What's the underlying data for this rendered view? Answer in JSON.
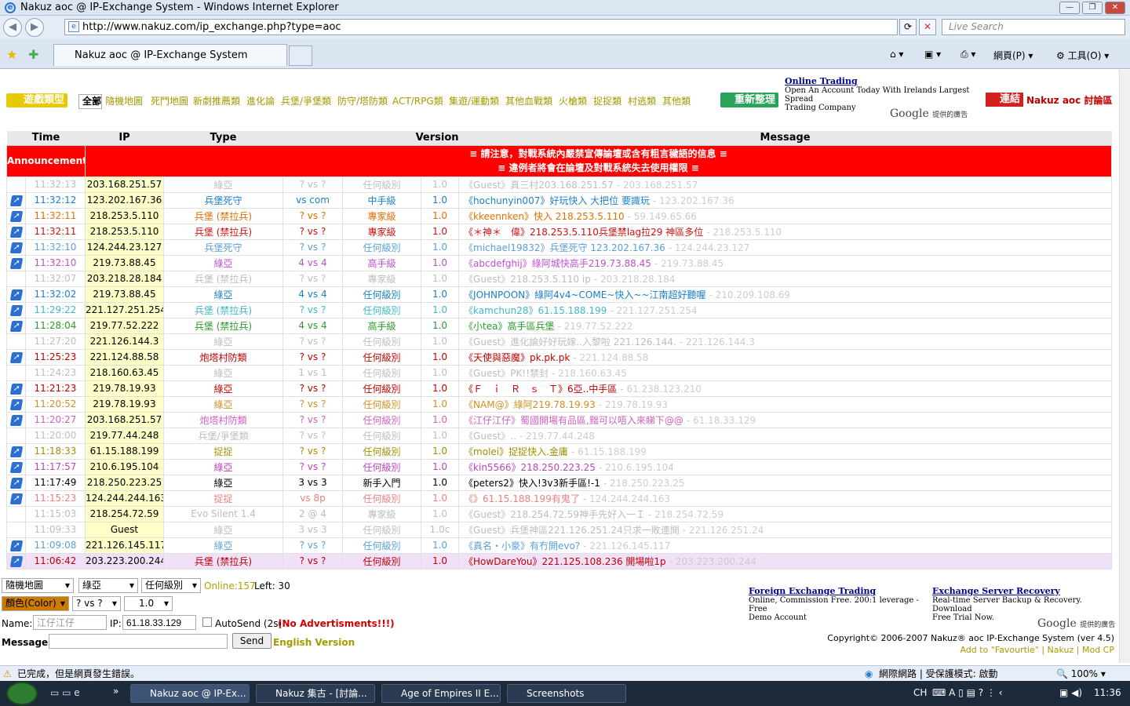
{
  "window": {
    "title": "Nakuz aoc @ IP-Exchange System - Windows Internet Explorer"
  },
  "nav": {
    "url": "http://www.nakuz.com/ip_exchange.php?type=aoc",
    "search_placeholder": "Live Search"
  },
  "tab": {
    "label": "Nakuz aoc @ IP-Exchange System"
  },
  "commands": {
    "page": "網頁(P)",
    "tools": "工具(O)"
  },
  "header": {
    "game_type_label": "遊戲類型",
    "categories": [
      "全部",
      "隨機地圖",
      "死鬥地圖",
      "新劇推薦類",
      "進化論",
      "兵堡/爭堡類",
      "防守/塔防類",
      "ACT/RPG類",
      "集遊/運動類",
      "其他血戰類",
      "火槍類",
      "捉捉類",
      "村逃類",
      "其他類"
    ],
    "renew_label": "重新整理",
    "link_label": "連結",
    "forum_link": "Nakuz  aoc 討論區"
  },
  "ad_top": {
    "title": "Online Trading",
    "line1": "Open An Account Today With Irelands Largest Spread",
    "line2": "Trading Company",
    "google": "Google",
    "google_sub": "提供的廣告"
  },
  "columns": {
    "time": "Time",
    "ip": "IP",
    "type": "Type",
    "version": "Version",
    "message": "Message"
  },
  "announcement": {
    "label": "Announcement",
    "line1": "≡ 請注意，對戰系統內嚴禁宣傳論壇或含有粗言穢語的信息 ≡",
    "line2": "≡ 違例者將會在論壇及對戰系統失去使用權限 ≡"
  },
  "rows": [
    {
      "icon": false,
      "time": "11:32:13",
      "ip": "203.168.251.57",
      "type": "綠亞",
      "vs": "? vs ?",
      "level": "任何級別",
      "ver": "1.0",
      "msg": "《Guest》真三村203.168.251.57",
      "ip2": "- 203.168.251.57",
      "color": "#bdbdbd"
    },
    {
      "icon": true,
      "time": "11:32:12",
      "ip": "123.202.167.36",
      "type": "兵堡死守",
      "vs": "vs com",
      "level": "中手級",
      "ver": "1.0",
      "msg": "《hochunyin007》好玩快入 大把位 要識玩",
      "ip2": "- 123.202.167.36",
      "color": "#1a7fc8"
    },
    {
      "icon": true,
      "time": "11:32:11",
      "ip": "218.253.5.110",
      "type": "兵堡 (禁拉兵)",
      "vs": "? vs ?",
      "level": "專家級",
      "ver": "1.0",
      "msg": "《kkeennken》快入 218.253.5.110",
      "ip2": "- 59.149.65.66",
      "color": "#e07000"
    },
    {
      "icon": true,
      "time": "11:32:11",
      "ip": "218.253.5.110",
      "type": "兵堡 (禁拉兵)",
      "vs": "? vs ?",
      "level": "專家級",
      "ver": "1.0",
      "msg": "《＊神＊　偉》218.253.5.110兵堡禁lag拉29 神區多位",
      "ip2": "- 218.253.5.110",
      "color": "#d01010"
    },
    {
      "icon": true,
      "time": "11:32:10",
      "ip": "124.244.23.127",
      "type": "兵堡死守",
      "vs": "? vs ?",
      "level": "任何級別",
      "ver": "1.0",
      "msg": "《michael19832》兵堡死守 123.202.167.36",
      "ip2": "- 124.244.23.127",
      "color": "#5aa0d8"
    },
    {
      "icon": true,
      "time": "11:32:10",
      "ip": "219.73.88.45",
      "type": "綠亞",
      "vs": "4 vs 4",
      "level": "高手級",
      "ver": "1.0",
      "msg": "《abcdefghij》綠阿城快高手219.73.88.45",
      "ip2": "- 219.73.88.45",
      "color": "#c050d0"
    },
    {
      "icon": false,
      "time": "11:32:07",
      "ip": "203.218.28.184",
      "type": "兵堡 (禁拉兵)",
      "vs": "? vs ?",
      "level": "專家級",
      "ver": "1.0",
      "msg": "《Guest》218.253.5.110 ip",
      "ip2": "- 203.218.28.184",
      "color": "#bdbdbd"
    },
    {
      "icon": true,
      "time": "11:32:02",
      "ip": "219.73.88.45",
      "type": "綠亞",
      "vs": "4 vs 4",
      "level": "任何級別",
      "ver": "1.0",
      "msg": "《JOHNPOON》綠阿4v4~COME~快入~~江南超好聽喔",
      "ip2": "- 210.209.108.69",
      "color": "#1a7fc8"
    },
    {
      "icon": true,
      "time": "11:29:22",
      "ip": "221.127.251.254",
      "type": "兵堡 (禁拉兵)",
      "vs": "? vs ?",
      "level": "任何級別",
      "ver": "1.0",
      "msg": "《kamchun28》61.15.188.199",
      "ip2": "- 221.127.251.254",
      "color": "#40b8c8"
    },
    {
      "icon": true,
      "time": "11:28:04",
      "ip": "219.77.52.222",
      "type": "兵堡 (禁拉兵)",
      "vs": "4 vs 4",
      "level": "高手級",
      "ver": "1.0",
      "msg": "《小tea》高手區兵堡",
      "ip2": "- 219.77.52.222",
      "color": "#2a9a2a"
    },
    {
      "icon": false,
      "time": "11:27:20",
      "ip": "221.126.144.3",
      "type": "綠亞",
      "vs": "? vs ?",
      "level": "任何級別",
      "ver": "1.0",
      "msg": "《Guest》進化論好好玩嫁..入黎啦 221.126.144.",
      "ip2": "- 221.126.144.3",
      "color": "#bdbdbd"
    },
    {
      "icon": true,
      "time": "11:25:23",
      "ip": "221.124.88.58",
      "type": "炮塔村防類",
      "vs": "? vs ?",
      "level": "任何級別",
      "ver": "1.0",
      "msg": "《天使與惡魔》pk.pk.pk",
      "ip2": "- 221.124.88.58",
      "color": "#c00000"
    },
    {
      "icon": false,
      "time": "11:24:23",
      "ip": "218.160.63.45",
      "type": "綠亞",
      "vs": "1 vs 1",
      "level": "任何級別",
      "ver": "1.0",
      "msg": "《Guest》PK!!禁封",
      "ip2": "- 218.160.63.45",
      "color": "#bdbdbd"
    },
    {
      "icon": true,
      "time": "11:21:23",
      "ip": "219.78.19.93",
      "type": "綠亞",
      "vs": "? vs ?",
      "level": "任何級別",
      "ver": "1.0",
      "msg": "《Ｆ　ｉ　Ｒ　ｓ　Ｔ》6亞..中手區",
      "ip2": "- 61.238.123.210",
      "color": "#c00000"
    },
    {
      "icon": true,
      "time": "11:20:52",
      "ip": "219.78.19.93",
      "type": "綠亞",
      "vs": "? vs ?",
      "level": "任何級別",
      "ver": "1.0",
      "msg": "《NAM@》綠阿219.78.19.93",
      "ip2": "- 219.78.19.93",
      "color": "#d09020"
    },
    {
      "icon": true,
      "time": "11:20:27",
      "ip": "203.168.251.57",
      "type": "炮塔村防類",
      "vs": "? vs ?",
      "level": "任何級別",
      "ver": "1.0",
      "msg": "《江仔江仔》蜀國開場有品區,黜可以唔入來睇下@@",
      "ip2": "- 61.18.33.129",
      "color": "#d060c0"
    },
    {
      "icon": false,
      "time": "11:20:00",
      "ip": "219.77.44.248",
      "type": "兵堡/爭堡類",
      "vs": "? vs ?",
      "level": "任何級別",
      "ver": "1.0",
      "msg": "《Guest》..",
      "ip2": "- 219.77.44.248",
      "color": "#bdbdbd"
    },
    {
      "icon": true,
      "time": "11:18:33",
      "ip": "61.15.188.199",
      "type": "捉捉",
      "vs": "? vs ?",
      "level": "任何級別",
      "ver": "1.0",
      "msg": "《molei》捉捉快入.金庸",
      "ip2": "- 61.15.188.199",
      "color": "#a09000"
    },
    {
      "icon": true,
      "time": "11:17:57",
      "ip": "210.6.195.104",
      "type": "綠亞",
      "vs": "? vs ?",
      "level": "任何級別",
      "ver": "1.0",
      "msg": "《kin5566》218.250.223.25",
      "ip2": "- 210.6.195.104",
      "color": "#c040c0"
    },
    {
      "icon": true,
      "time": "11:17:49",
      "ip": "218.250.223.25",
      "type": "綠亞",
      "vs": "3 vs 3",
      "level": "新手入門",
      "ver": "1.0",
      "msg": "《peters2》快入!3v3新手區!-1",
      "ip2": "- 218.250.223.25",
      "color": "#000000"
    },
    {
      "icon": true,
      "time": "11:15:23",
      "ip": "124.244.244.163",
      "type": "捉捉",
      "vs": "vs 8p",
      "level": "任何級別",
      "ver": "1.0",
      "msg": "《》61.15.188.199有鬼了",
      "ip2": "- 124.244.244.163",
      "color": "#e88080"
    },
    {
      "icon": false,
      "time": "11:15:03",
      "ip": "218.254.72.59",
      "type": "Evo Silent 1.4",
      "vs": "2 @ 4",
      "level": "專家級",
      "ver": "1.0",
      "msg": "《Guest》218.254.72.59神手先好入一Ｉ",
      "ip2": "- 218.254.72.59",
      "color": "#bdbdbd"
    },
    {
      "icon": false,
      "time": "11:09:33",
      "ip": "Guest",
      "type": "綠亞",
      "vs": "3 vs 3",
      "level": "任何級別",
      "ver": "1.0c",
      "msg": "《Guest》兵堡神區221.126.251.24只求一敗連開",
      "ip2": "- 221.126.251.24",
      "color": "#bdbdbd"
    },
    {
      "icon": true,
      "time": "11:09:08",
      "ip": "221.126.145.117",
      "type": "綠亞",
      "vs": "? vs ?",
      "level": "任何級別",
      "ver": "1.0",
      "msg": "《真名・小豪》有冇開evo?",
      "ip2": "- 221.126.145.117",
      "color": "#5aa0d8"
    },
    {
      "icon": true,
      "time": "11:06:42",
      "ip": "203.223.200.244",
      "type": "兵堡 (禁拉兵)",
      "vs": "? vs ?",
      "level": "任何級別",
      "ver": "1.0",
      "msg": "《HowDareYou》221.125.108.236 開場啦1p",
      "ip2": "- 203.223.200.244",
      "color": "#c00000",
      "pink": true
    }
  ],
  "form": {
    "map": "隨機地圖",
    "civ": "綠亞",
    "level": "任何級別",
    "color": "顏色(Color)",
    "vs": "? vs ?",
    "version": "1.0",
    "online": "Online:157",
    "left": "Left: 30",
    "name_label": "Name:",
    "name_value": "江仔江仔",
    "ip_label": "IP:",
    "ip_value": "61.18.33.129",
    "autosend": "AutoSend (2s)",
    "noads": "(No Advertisments!!!)",
    "message_label": "Message:",
    "send": "Send",
    "english": "English Version"
  },
  "ads_bottom": [
    {
      "title": "Foreign Exchange Trading",
      "line1": "Online, Commission Free. 200:1 leverage - Free",
      "line2": "Demo Account"
    },
    {
      "title": "Exchange Server Recovery",
      "line1": "Real-time Server Backup & Recovery. Download",
      "line2": "Free Trial Now."
    }
  ],
  "footer": {
    "copyright": "Copyright© 2006-2007  Nakuz® aoc IP-Exchange System (ver 4.5)",
    "fav": "Add to \"Favourtie\"",
    "nakuz": "Nakuz",
    "modcp": "Mod CP"
  },
  "status": {
    "text": "已完成，但是網頁發生錯誤。",
    "zone": "網際網路 | 受保護模式: 啟動",
    "zoom": "100%"
  },
  "taskbar": {
    "items": [
      "Nakuz aoc @ IP-Ex...",
      "Nakuz 集古 - [討論...",
      "Age of Empires II E...",
      "Screenshots"
    ],
    "lang": "CH",
    "clock": "11:36"
  }
}
